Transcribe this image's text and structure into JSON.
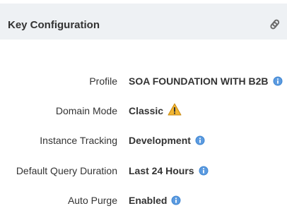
{
  "header": {
    "title": "Key Configuration"
  },
  "rows": [
    {
      "label": "Profile",
      "value": "SOA FOUNDATION WITH B2B",
      "icon": "info-icon"
    },
    {
      "label": "Domain Mode",
      "value": "Classic",
      "icon": "warning-icon"
    },
    {
      "label": "Instance Tracking",
      "value": "Development",
      "icon": "info-icon"
    },
    {
      "label": "Default Query Duration",
      "value": "Last 24 Hours",
      "icon": "info-icon"
    },
    {
      "label": "Auto Purge",
      "value": "Enabled",
      "icon": "info-icon"
    }
  ],
  "colors": {
    "header_bg": "#eef1f4",
    "info_blue": "#3f86d2",
    "warning_yellow": "#f2b632",
    "text": "#333333"
  }
}
